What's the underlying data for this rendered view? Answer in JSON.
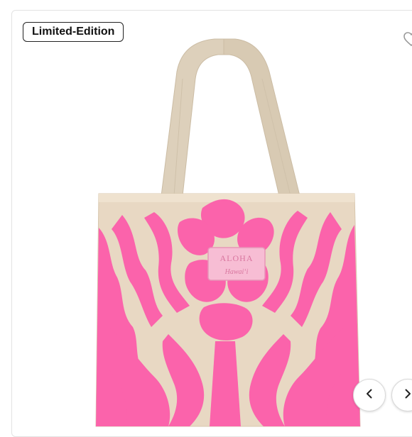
{
  "product": {
    "badge_label": "Limited-Edition",
    "label_patch": {
      "brand": "ALOHA",
      "script": "Hawaiʻi"
    }
  },
  "icons": {
    "favorite": "heart-outline-icon",
    "prev": "chevron-left-icon",
    "next": "chevron-right-icon"
  },
  "colors": {
    "bag_canvas": "#e8d8c3",
    "print_pink": "#fb63ab",
    "strap": "#ddd0bb",
    "badge_border": "#222222"
  }
}
